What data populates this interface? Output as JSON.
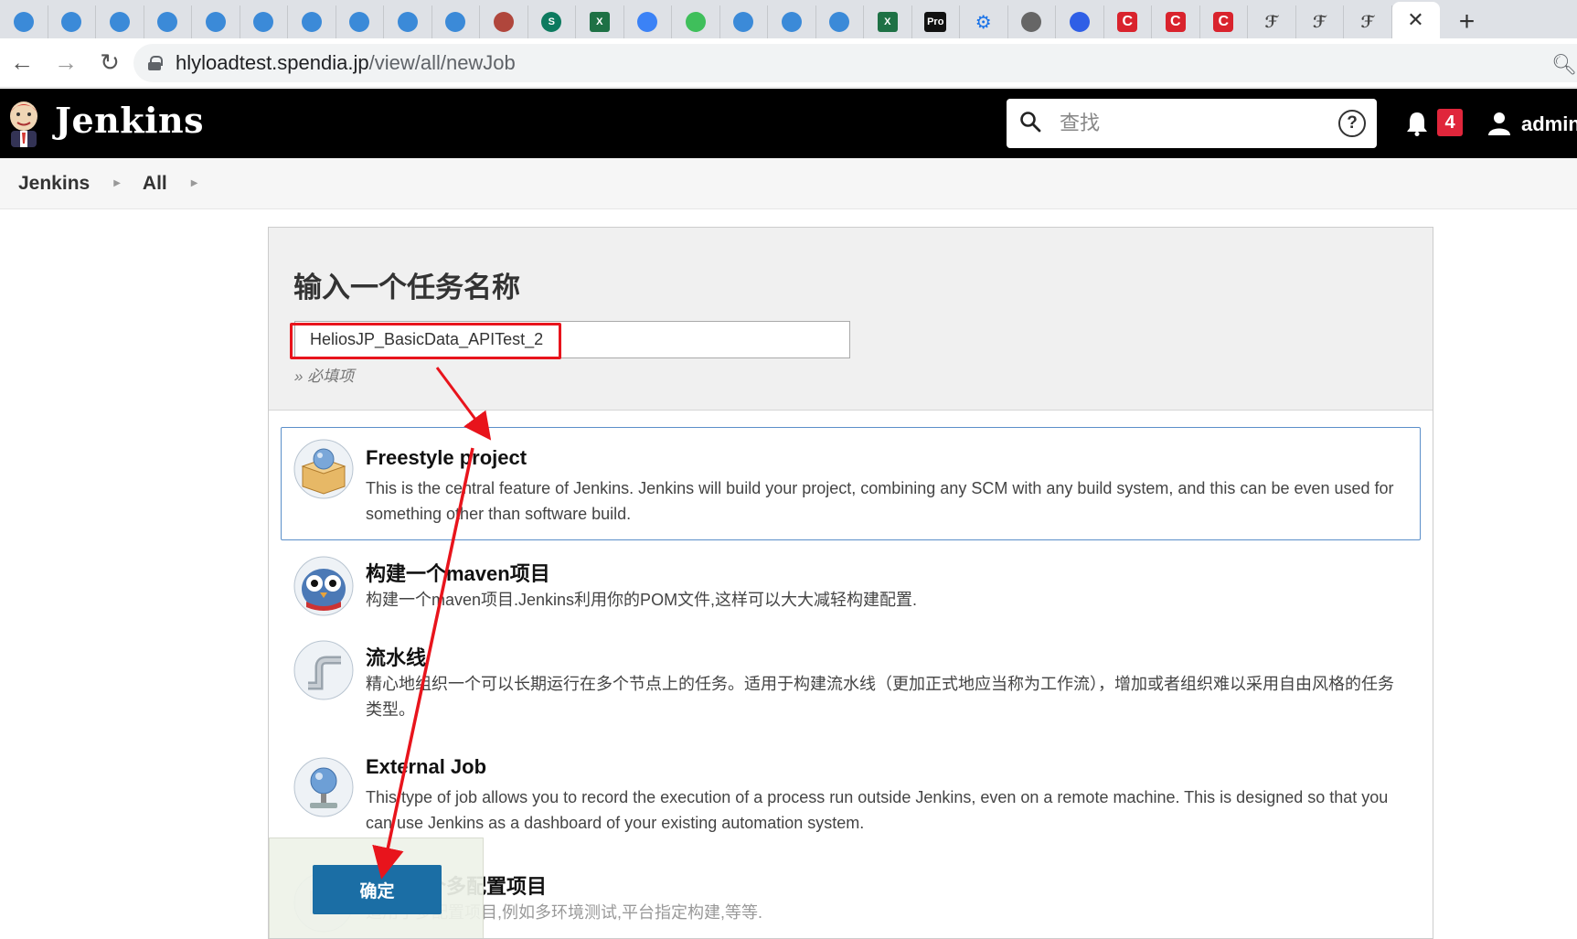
{
  "browser": {
    "tabs": [
      {
        "icon": "web-globe-icon",
        "color": "#3b8ad8"
      },
      {
        "icon": "web-globe-icon",
        "color": "#3b8ad8"
      },
      {
        "icon": "web-globe-icon",
        "color": "#3b8ad8"
      },
      {
        "icon": "web-globe-icon",
        "color": "#3b8ad8"
      },
      {
        "icon": "web-globe-icon",
        "color": "#3b8ad8"
      },
      {
        "icon": "web-globe-icon",
        "color": "#3b8ad8"
      },
      {
        "icon": "web-globe-icon",
        "color": "#3b8ad8"
      },
      {
        "icon": "web-globe-icon",
        "color": "#3b8ad8"
      },
      {
        "icon": "web-globe-icon",
        "color": "#3b8ad8"
      },
      {
        "icon": "web-globe-icon",
        "color": "#3b8ad8"
      },
      {
        "icon": "jenkins-avatar-icon",
        "color": "#b0463c"
      },
      {
        "icon": "sharepoint-icon",
        "color": "#0d7a5f"
      },
      {
        "icon": "excel-icon",
        "color": "#1e7145"
      },
      {
        "icon": "note-icon",
        "color": "#3b82f6"
      },
      {
        "icon": "json-icon",
        "color": "#3fbf5b"
      },
      {
        "icon": "web-globe-icon",
        "color": "#3b8ad8"
      },
      {
        "icon": "web-globe-icon",
        "color": "#3b8ad8"
      },
      {
        "icon": "web-globe-icon",
        "color": "#3b8ad8"
      },
      {
        "icon": "excel-icon",
        "color": "#1e7145"
      },
      {
        "icon": "pro-icon",
        "color": "#111111",
        "label": "Pro"
      },
      {
        "icon": "gear-icon",
        "color": "#1a73e8"
      },
      {
        "icon": "globe-gray-icon",
        "color": "#666666"
      },
      {
        "icon": "baidu-icon",
        "color": "#2f5fe6"
      },
      {
        "icon": "c-icon",
        "color": "#d9232d"
      },
      {
        "icon": "c-icon",
        "color": "#d9232d"
      },
      {
        "icon": "c-icon",
        "color": "#d9232d"
      },
      {
        "icon": "script-icon",
        "color": "#444444"
      },
      {
        "icon": "script-icon",
        "color": "#444444"
      },
      {
        "icon": "script-icon",
        "color": "#444444"
      }
    ],
    "url_host": "hlyloadtest.spendia.jp",
    "url_path": "/view/all/newJob"
  },
  "header": {
    "app_name": "Jenkins",
    "search_placeholder": "查找",
    "notification_count": "4",
    "username": "admin"
  },
  "breadcrumb": [
    "Jenkins",
    "All"
  ],
  "form": {
    "title": "输入一个任务名称",
    "job_name_value": "HeliosJP_BasicData_APITest_2",
    "required_note": "» 必填项"
  },
  "job_types": [
    {
      "name": "Freestyle project",
      "description": "This is the central feature of Jenkins. Jenkins will build your project, combining any SCM with any build system, and this can be even used for something other than software build.",
      "icon": "freestyle-box-icon"
    },
    {
      "name": "构建一个maven项目",
      "description": "构建一个maven项目.Jenkins利用你的POM文件,这样可以大大减轻构建配置.",
      "icon": "maven-owl-icon"
    },
    {
      "name": "流水线",
      "description": "精心地组织一个可以长期运行在多个节点上的任务。适用于构建流水线（更加正式地应当称为工作流），增加或者组织难以采用自由风格的任务类型。",
      "icon": "pipeline-icon"
    },
    {
      "name": "External Job",
      "description": "This type of job allows you to record the execution of a process run outside Jenkins, even on a remote machine. This is designed so that you can use Jenkins as a dashboard of your existing automation system.",
      "icon": "external-job-icon"
    },
    {
      "name": "构建一个多配置项目",
      "description": "适用于多配置项目,例如多环境测试,平台指定构建,等等.",
      "icon": "multi-config-icon"
    }
  ],
  "ok_button_label": "确定",
  "colors": {
    "annotation_red": "#e8141c",
    "ok_button": "#1b6ea5",
    "selected_border": "#5b8fc9"
  }
}
